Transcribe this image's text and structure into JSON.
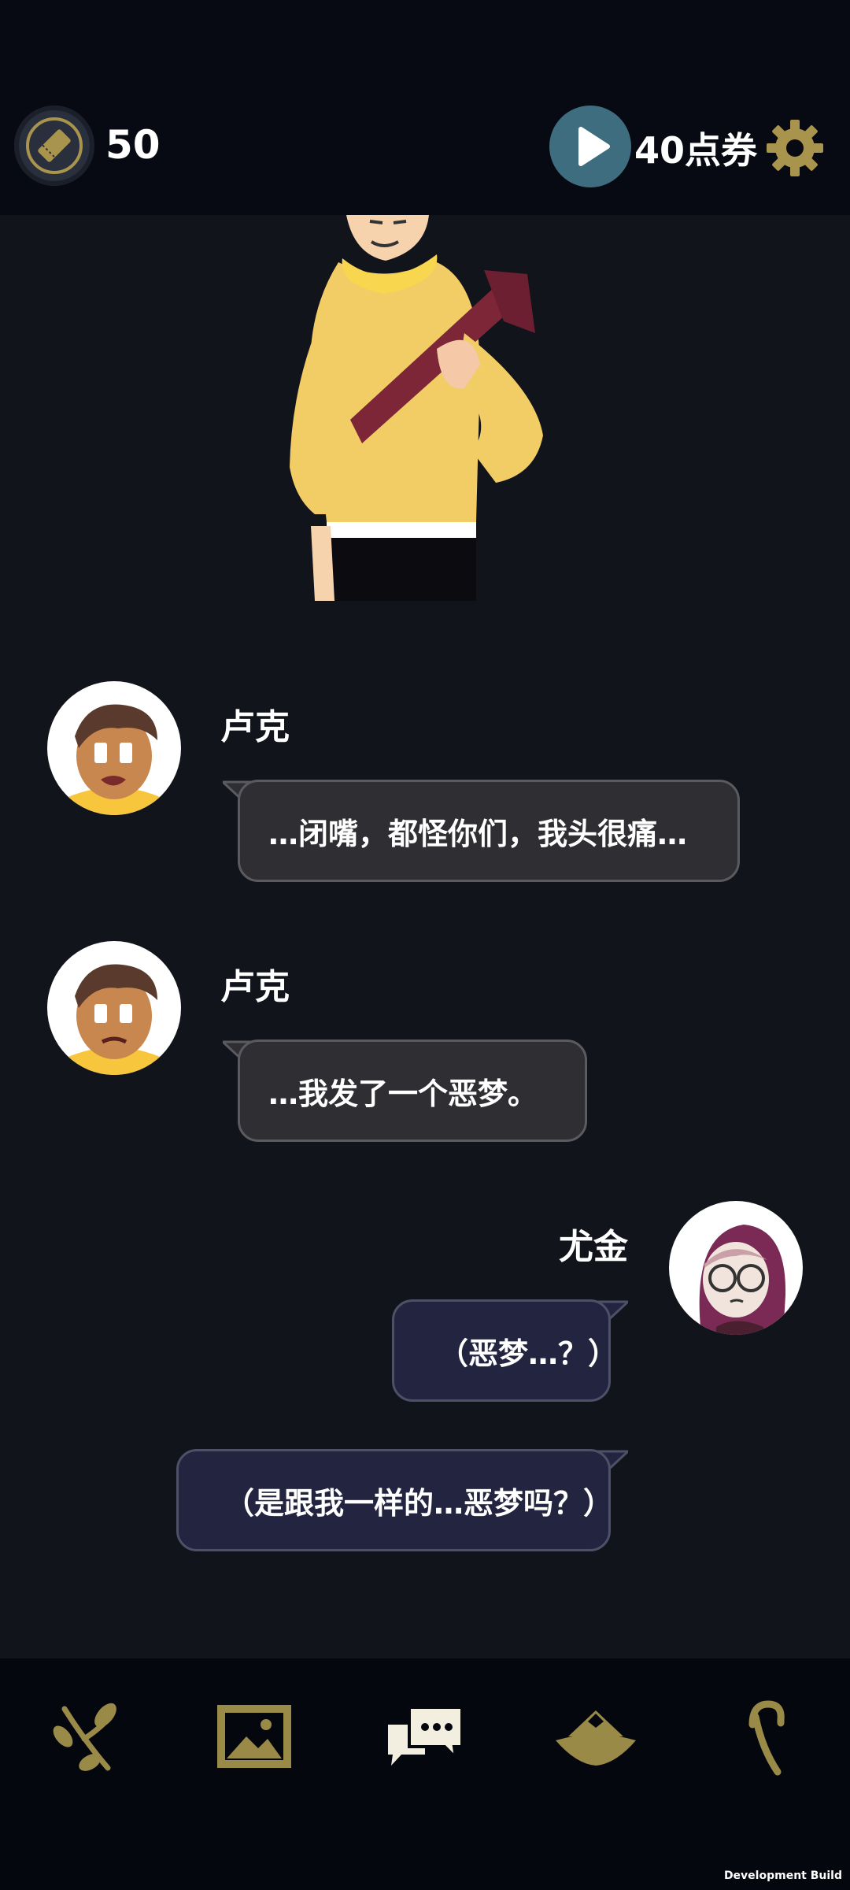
{
  "topbar": {
    "ticket_count": "50",
    "vouchers_label": "40点券",
    "icons": {
      "ticket": "ticket-icon",
      "play": "play-icon",
      "settings": "gear-icon"
    },
    "colors": {
      "accent_gold": "#a8944c",
      "play_teal": "#3f6d80"
    }
  },
  "messages": [
    {
      "speaker": "卢克",
      "text": "…闭嘴，都怪你们，我头很痛…",
      "side": "left"
    },
    {
      "speaker": "卢克",
      "text": "…我发了一个恶梦。",
      "side": "left"
    },
    {
      "speaker": "尤金",
      "text": "（恶梦…？）",
      "side": "right"
    },
    {
      "speaker": "尤金",
      "text": "（是跟我一样的…恶梦吗？）",
      "side": "right"
    }
  ],
  "nav": {
    "items": [
      {
        "icon": "branch-icon"
      },
      {
        "icon": "gallery-icon"
      },
      {
        "icon": "chat-icon"
      },
      {
        "icon": "hat-icon"
      },
      {
        "icon": "cane-icon"
      }
    ],
    "colors": {
      "inactive": "#9a8a48",
      "active": "#f2eee0"
    }
  },
  "footer": {
    "build_label": "Development Build"
  }
}
